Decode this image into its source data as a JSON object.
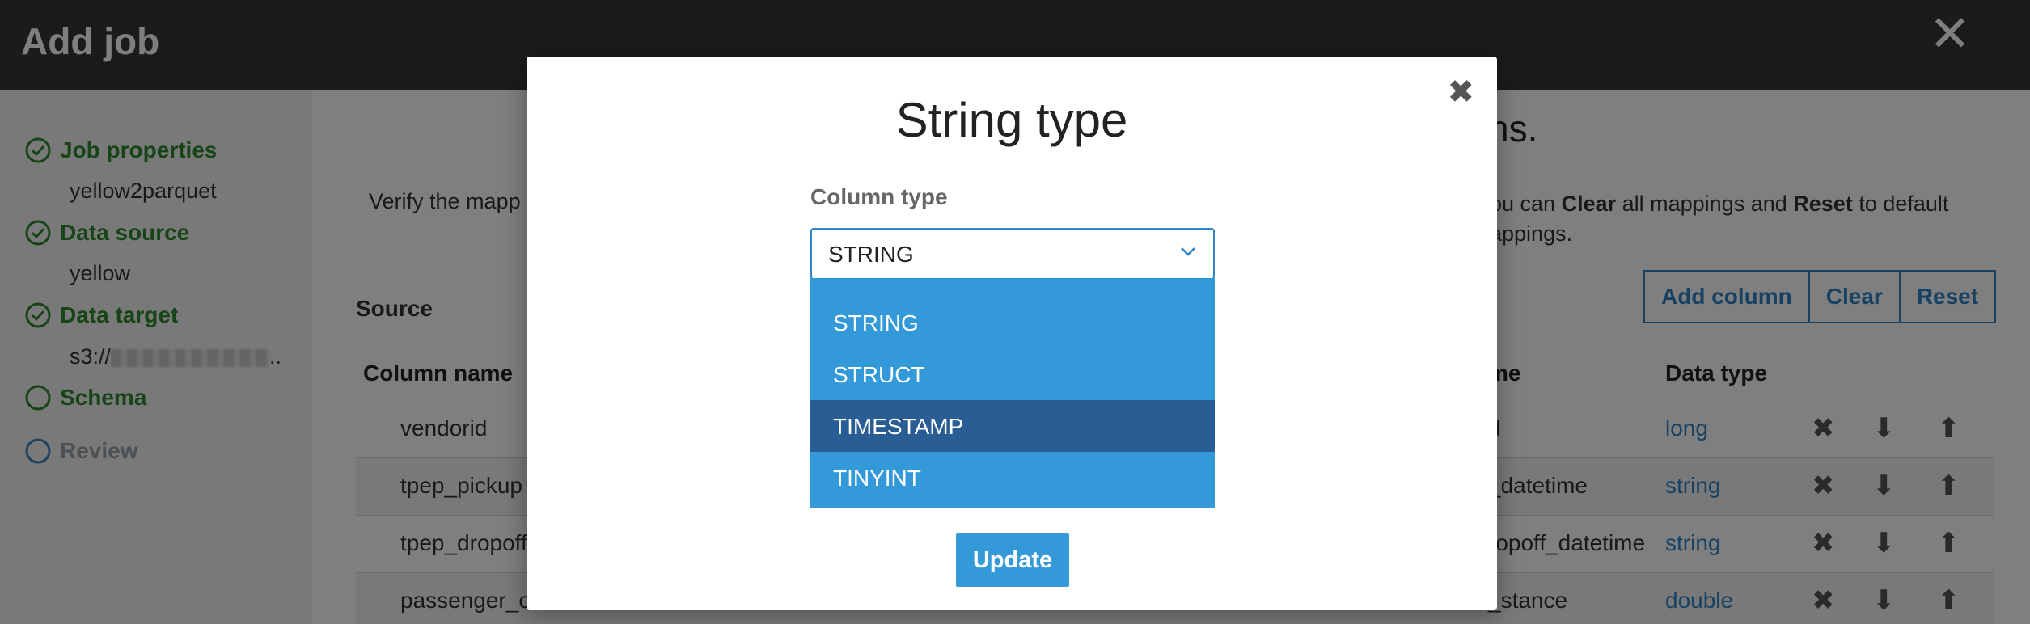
{
  "header": {
    "title": "Add job"
  },
  "sidebar": {
    "steps": [
      {
        "label": "Job properties",
        "sub": "yellow2parquet"
      },
      {
        "label": "Data source",
        "sub": "yellow"
      },
      {
        "label": "Data target",
        "sub": "s3://"
      },
      {
        "label": "Schema"
      },
      {
        "label": "Review"
      }
    ],
    "target_suffix": ".."
  },
  "main": {
    "title_fragment": "ns.",
    "description_left": "Verify the mapp",
    "description_right_1": "ou can ",
    "clear_bold": "Clear",
    "description_right_2": " all mappings and ",
    "reset_bold": "Reset",
    "description_right_3": " to default",
    "description_right_4": "appings.",
    "buttons": {
      "add_column": "Add column",
      "clear": "Clear",
      "reset": "Reset"
    },
    "source_label": "Source",
    "headers": {
      "column_name": "Column name",
      "target_col_fragment": "me",
      "data_type": "Data type"
    },
    "rows": [
      {
        "source": "vendorid",
        "target": "d",
        "type": "long"
      },
      {
        "source": "tpep_pickup",
        "target": "_datetime",
        "type": "string"
      },
      {
        "source": "tpep_dropoff",
        "target": "ropoff_datetime",
        "type": "string"
      },
      {
        "source": "passenger_c",
        "target": "_stance",
        "type": "double"
      }
    ]
  },
  "modal": {
    "title": "String type",
    "column_type_label": "Column type",
    "selected_value": "STRING",
    "options": [
      "STRING",
      "STRUCT",
      "TIMESTAMP",
      "TINYINT"
    ],
    "highlighted_option": "TIMESTAMP",
    "update_button": "Update"
  },
  "colors": {
    "header_bg": "#33373b",
    "complete_green": "#2e8b2e",
    "accent_blue": "#3499d8",
    "selected_option": "#2a5d93"
  }
}
